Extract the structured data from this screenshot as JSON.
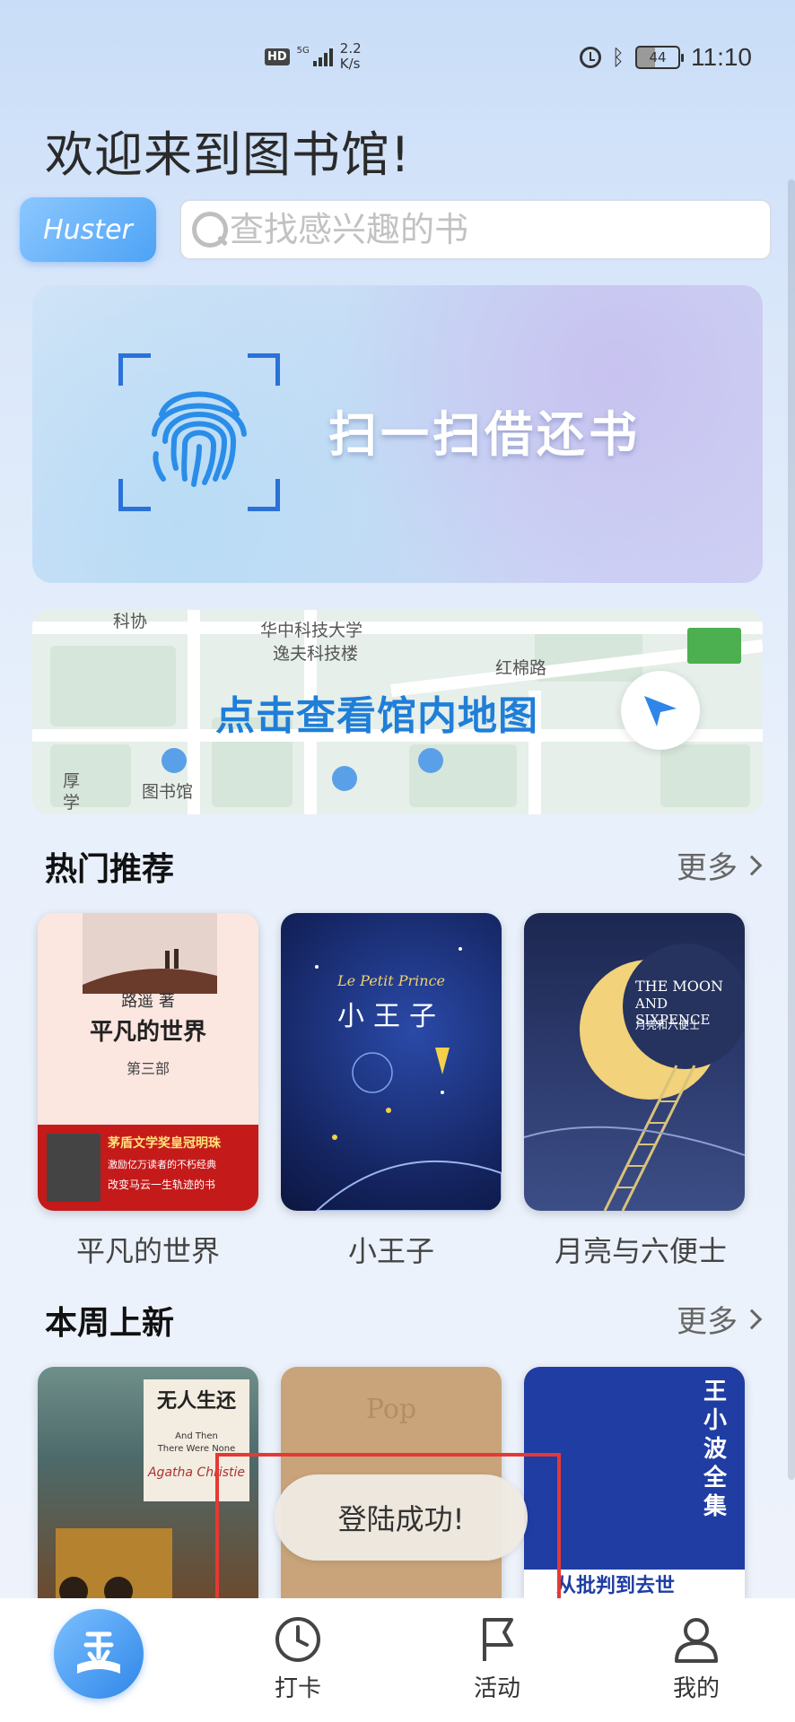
{
  "status_bar": {
    "hd": "HD",
    "network": "5G",
    "net_speed_value": "2.2",
    "net_speed_unit": "K/s",
    "battery": "44",
    "time": "11:10"
  },
  "header": {
    "welcome": "欢迎来到图书馆!",
    "user_chip": "Huster",
    "search_placeholder": "查找感兴趣的书"
  },
  "scan_banner": {
    "label": "扫一扫借还书"
  },
  "map_banner": {
    "cta": "点击查看馆内地图",
    "places": [
      "科协",
      "华中科技大学",
      "逸夫科技楼",
      "红棉路",
      "图书馆",
      "厚",
      "学"
    ]
  },
  "hot": {
    "title": "热门推荐",
    "more": "更多",
    "books": [
      {
        "title": "平凡的世界",
        "cover_author": "路遥 著",
        "cover_title": "平凡的世界",
        "cover_part": "第三部",
        "cover_band": "茅盾文学奖皇冠明珠",
        "cover_band2": "激励亿万读者的不朽经典",
        "cover_band3": "改变马云一生轨迹的书"
      },
      {
        "title": "小王子",
        "cover_title": "小王子",
        "cover_script": "Le Petit Prince"
      },
      {
        "title": "月亮与六便士",
        "cover_title_en1": "THE MOON",
        "cover_title_en2": "AND SIXPENCE",
        "cover_title_cn": "月亮和六便士"
      }
    ]
  },
  "new": {
    "title": "本周上新",
    "more": "更多",
    "books": [
      {
        "cover_title": "无人生还",
        "cover_en1": "And Then",
        "cover_en2": "There Were None",
        "cover_author": "Agatha Christie"
      },
      {
        "cover_title": "Pop"
      },
      {
        "cover_title": "王小波全集",
        "cover_subtitle": "从批判到去世"
      }
    ]
  },
  "toast": {
    "message": "登陆成功!"
  },
  "bottom_nav": {
    "items": [
      {
        "label": "打卡",
        "icon": "clock-icon"
      },
      {
        "label": "活动",
        "icon": "flag-icon"
      },
      {
        "label": "我的",
        "icon": "user-icon"
      }
    ]
  },
  "colors": {
    "accent": "#2f86e8",
    "map_cta": "#1f7ed8",
    "toast_frame": "#e53935"
  }
}
